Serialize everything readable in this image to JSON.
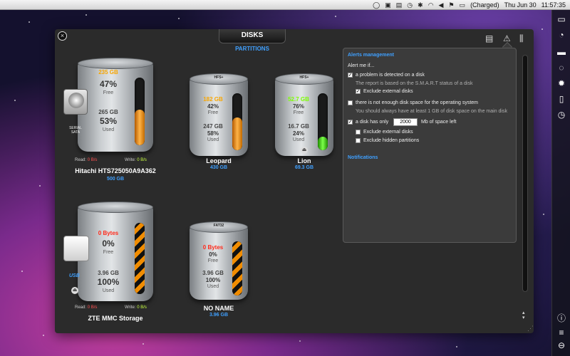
{
  "menubar": {
    "battery": "(Charged)",
    "date": "Thu Jun 30",
    "time": "11:57:35",
    "icons": [
      "chat-icon",
      "monitor-icon",
      "contacts-icon",
      "time-machine-icon",
      "bluetooth-icon",
      "wifi-icon",
      "volume-icon",
      "flag-icon",
      "battery-icon"
    ]
  },
  "panel": {
    "tab_label": "DISKS",
    "subtab_label": "PARTITIONS",
    "close_label": "×"
  },
  "disks": [
    {
      "name": "Hitachi HTS725050A9A362",
      "size": "500 GB",
      "free_gb": "235 GB",
      "free_pct": "47%",
      "free_label": "Free",
      "used_gb": "265 GB",
      "used_pct": "53%",
      "used_label": "Used",
      "read_label": "Read:",
      "read_value": "0 B/s",
      "write_label": "Write:",
      "write_value": "0 B/s",
      "icon_label": "SERIAL\nSATA",
      "fill_pct": 53
    },
    {
      "name": "Leopard",
      "size": "430 GB",
      "fs": "HFS+",
      "free_gb": "182 GB",
      "free_pct": "42%",
      "free_label": "Free",
      "used_gb": "247 GB",
      "used_pct": "58%",
      "used_label": "Used",
      "fill_pct": 58
    },
    {
      "name": "Lion",
      "size": "69.3 GB",
      "fs": "HFS+",
      "free_gb": "52.7 GB",
      "free_pct": "76%",
      "free_label": "Free",
      "used_gb": "16.7 GB",
      "used_pct": "24%",
      "used_label": "Used",
      "fill_pct": 24
    },
    {
      "name": "ZTE MMC Storage",
      "size": "",
      "free_gb": "0 Bytes",
      "free_pct": "0%",
      "free_label": "Free",
      "used_gb": "3.96 GB",
      "used_pct": "100%",
      "used_label": "Used",
      "read_label": "Read:",
      "read_value": "0 B/s",
      "write_label": "Write:",
      "write_value": "0 B/s",
      "icon_label": "USB",
      "fill_pct": 100
    },
    {
      "name": "NO NAME",
      "size": "3.96 GB",
      "fs": "FAT32",
      "free_gb": "0 Bytes",
      "free_pct": "0%",
      "free_label": "Free",
      "used_gb": "3.96 GB",
      "used_pct": "100%",
      "used_label": "Used",
      "fill_pct": 100
    }
  ],
  "alerts": {
    "title": "Alerts management",
    "intro": "Alert me if...",
    "opt1_label": "a problem is detected on a disk",
    "opt1_checked": true,
    "opt1_sub": "The report is based on the S.M.A.R.T status of a disk",
    "opt1_exclude": "Exclude external disks",
    "opt1_exclude_checked": true,
    "opt2_label": "there is not enough disk space for the operating system",
    "opt2_checked": false,
    "opt2_sub": "You should always have at least 1 GB of disk space on the main disk",
    "opt3_prefix": "a disk has only",
    "opt3_value": "2000",
    "opt3_suffix": "Mb of space left",
    "opt3_checked": true,
    "opt3_exclude_ext": "Exclude external disks",
    "opt3_exclude_hidden": "Exclude hidden partitions",
    "notifications": "Notifications"
  }
}
